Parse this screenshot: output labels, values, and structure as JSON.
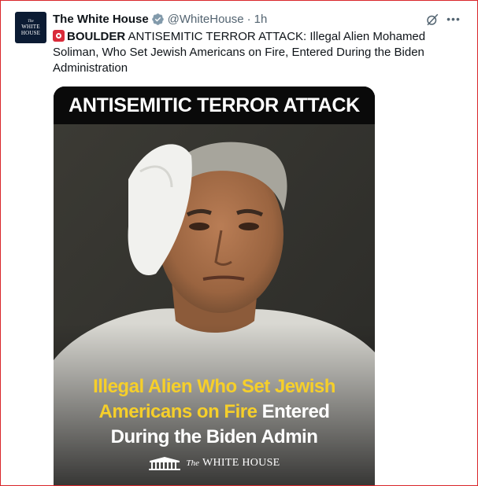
{
  "account": {
    "avatar_the": "The",
    "avatar_line1": "WHITE",
    "avatar_line2": "HOUSE",
    "name": "The White House",
    "handle": "@WhiteHouse",
    "separator": "·",
    "time": "1h"
  },
  "icons": {
    "verified": "verified-badge-icon",
    "grok": "grok-icon",
    "more": "more-options-icon",
    "siren": "rotating-light-icon"
  },
  "tweet": {
    "bold_lead": "BOULDER",
    "text_rest": " ANTISEMITIC TERROR ATTACK: Illegal Alien Mohamed Soliman, Who Set Jewish Americans on Fire, Entered During the Biden Administration"
  },
  "media": {
    "headline": "ANTISEMITIC TERROR ATTACK",
    "caption_yellow_1": "Illegal Alien Who Set Jewish",
    "caption_yellow_2": "Americans on Fire",
    "caption_white_2": " Entered",
    "caption_white_3": "During the Biden Admin",
    "logo_the": "The",
    "logo_wh": "WHITE HOUSE"
  },
  "colors": {
    "verified": "#829aab",
    "highlight": "#f6cf2a",
    "muted": "#536471",
    "siren": "#d92b3a"
  }
}
